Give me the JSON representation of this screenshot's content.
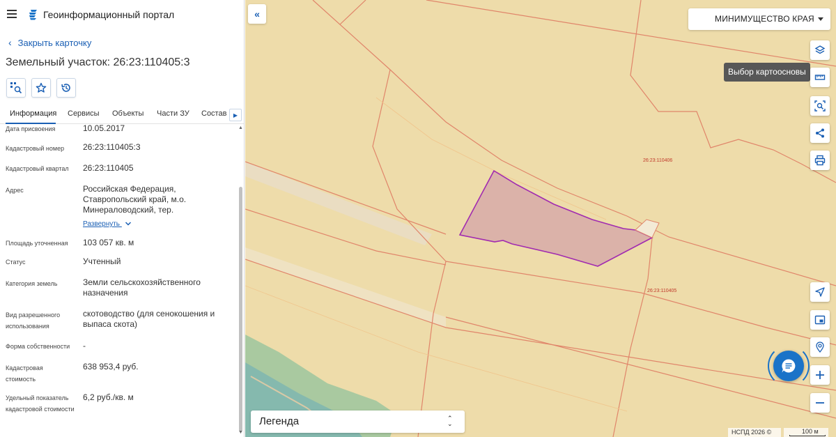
{
  "app": {
    "title": "Геоинформационный портал"
  },
  "card": {
    "close_label": "Закрыть карточку",
    "title": "Земельный участок: 26:23:110405:3"
  },
  "tabs": [
    {
      "label": "Информация"
    },
    {
      "label": "Сервисы"
    },
    {
      "label": "Объекты"
    },
    {
      "label": "Части ЗУ"
    },
    {
      "label": "Состав"
    }
  ],
  "fields": [
    {
      "label": "Дата присвоения",
      "value": "10.05.2017"
    },
    {
      "label": "Кадастровый номер",
      "value": "26:23:110405:3"
    },
    {
      "label": "Кадастровый квартал",
      "value": "26:23:110405"
    },
    {
      "label": "Адрес",
      "value": "Российская Федерация, Ставропольский край, м.о. Минераловодский, тер."
    },
    {
      "label": "Площадь уточненная",
      "value": "103 057 кв. м"
    },
    {
      "label": "Статус",
      "value": "Учтенный"
    },
    {
      "label": "Категория земель",
      "value": "Земли сельскохозяйственного назначения"
    },
    {
      "label": "Вид разрешенного использования",
      "value": "скотоводство (для сенокошения и выпаса скота)"
    },
    {
      "label": "Форма собственности",
      "value": "-"
    },
    {
      "label": "Кадастровая стоимость",
      "value": "638 953,4 руб."
    },
    {
      "label": "Удельный показатель кадастровой стоимости",
      "value": "6,2 руб./кв. м"
    }
  ],
  "expand_label": "Развернуть",
  "map": {
    "org_select": "МИНИМУЩЕСТВО КРАЯ",
    "tooltip": "Выбор картоосновы",
    "legend_label": "Легенда",
    "copyright": "НСПД 2026 ©",
    "scale": "100 м",
    "quarter_labels": [
      "26:23:110406",
      "26:23:110405"
    ]
  },
  "colors": {
    "accent": "#1a5fb4",
    "map_bg": "#eedcaa",
    "parcel_fill": "#dbb2a9",
    "parcel_stroke": "#a12bb0",
    "boundary": "#e0856a"
  },
  "icons": [
    "menu-icon",
    "portal-logo-icon",
    "chevron-left-icon",
    "locate-object-icon",
    "star-icon",
    "history-icon",
    "chevron-right-icon",
    "double-chevron-left-icon",
    "layers-icon",
    "ruler-icon",
    "select-area-icon",
    "share-icon",
    "print-icon",
    "navigation-icon",
    "minimap-icon",
    "location-search-icon",
    "chat-icon",
    "zoom-in-icon",
    "zoom-out-icon"
  ]
}
